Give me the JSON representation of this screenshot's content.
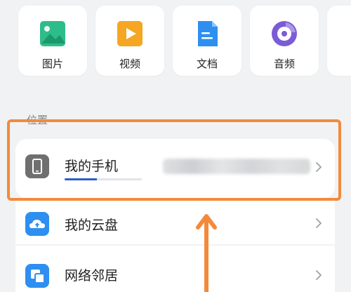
{
  "categories": [
    {
      "label": "图片",
      "icon": "image-icon",
      "color": "#2ebc8a"
    },
    {
      "label": "视频",
      "icon": "video-icon",
      "color": "#f5a623"
    },
    {
      "label": "文档",
      "icon": "document-icon",
      "color": "#2e8ff0"
    },
    {
      "label": "音频",
      "icon": "audio-icon",
      "color": "#7b5bd6"
    }
  ],
  "locations": {
    "section_title": "位置",
    "items": [
      {
        "label": "我的手机",
        "icon": "phone-icon",
        "storage_used_fraction": 0.42
      },
      {
        "label": "我的云盘",
        "icon": "cloud-drive-icon"
      },
      {
        "label": "网络邻居",
        "icon": "network-neighbor-icon"
      }
    ]
  },
  "colors": {
    "accent": "#2c5fc9",
    "highlight": "#f28a3c",
    "background": "#f1f2f4"
  }
}
